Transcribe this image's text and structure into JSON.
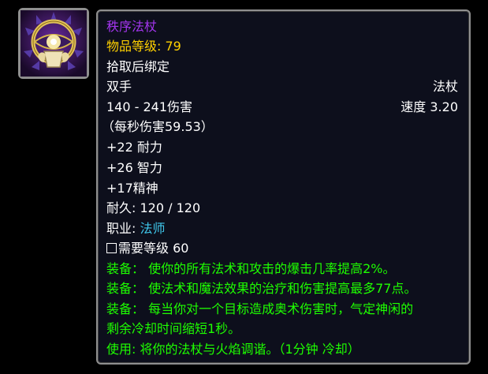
{
  "colors": {
    "epic": "#a335ee",
    "item_level": "#ffd100",
    "class": "#3fc7eb",
    "spell_effect": "#1eff00",
    "normal": "#ffffff",
    "tooltip_bg": "#0d0f1c",
    "border": "#8f8f8f"
  },
  "icon": {
    "name": "eye-orb-staff-icon"
  },
  "item": {
    "name": "秩序法杖",
    "item_level_label": "物品等级: ",
    "item_level": "79",
    "binding": "拾取后绑定",
    "slot": "双手",
    "type": "法杖",
    "damage": "140 - 241伤害",
    "speed": "速度 3.20",
    "dps": "（每秒伤害59.53）",
    "stats": [
      "+22 耐力",
      "+26 智力",
      "+17精神"
    ],
    "durability": "耐久: 120 / 120",
    "class_label": "职业: ",
    "class_value": "法师",
    "requirement": "需要等级 60",
    "effects": [
      "装备：  使你的所有法术和攻击的爆击几率提高2%。",
      "装备：  使法术和魔法效果的治疗和伤害提高最多77点。",
      "装备：  每当你对一个目标造成奥术伤害时，气定神闲的",
      "剩余冷却时间缩短1秒。",
      "使用: 将你的法杖与火焰调谐。（1分钟 冷却）"
    ]
  }
}
